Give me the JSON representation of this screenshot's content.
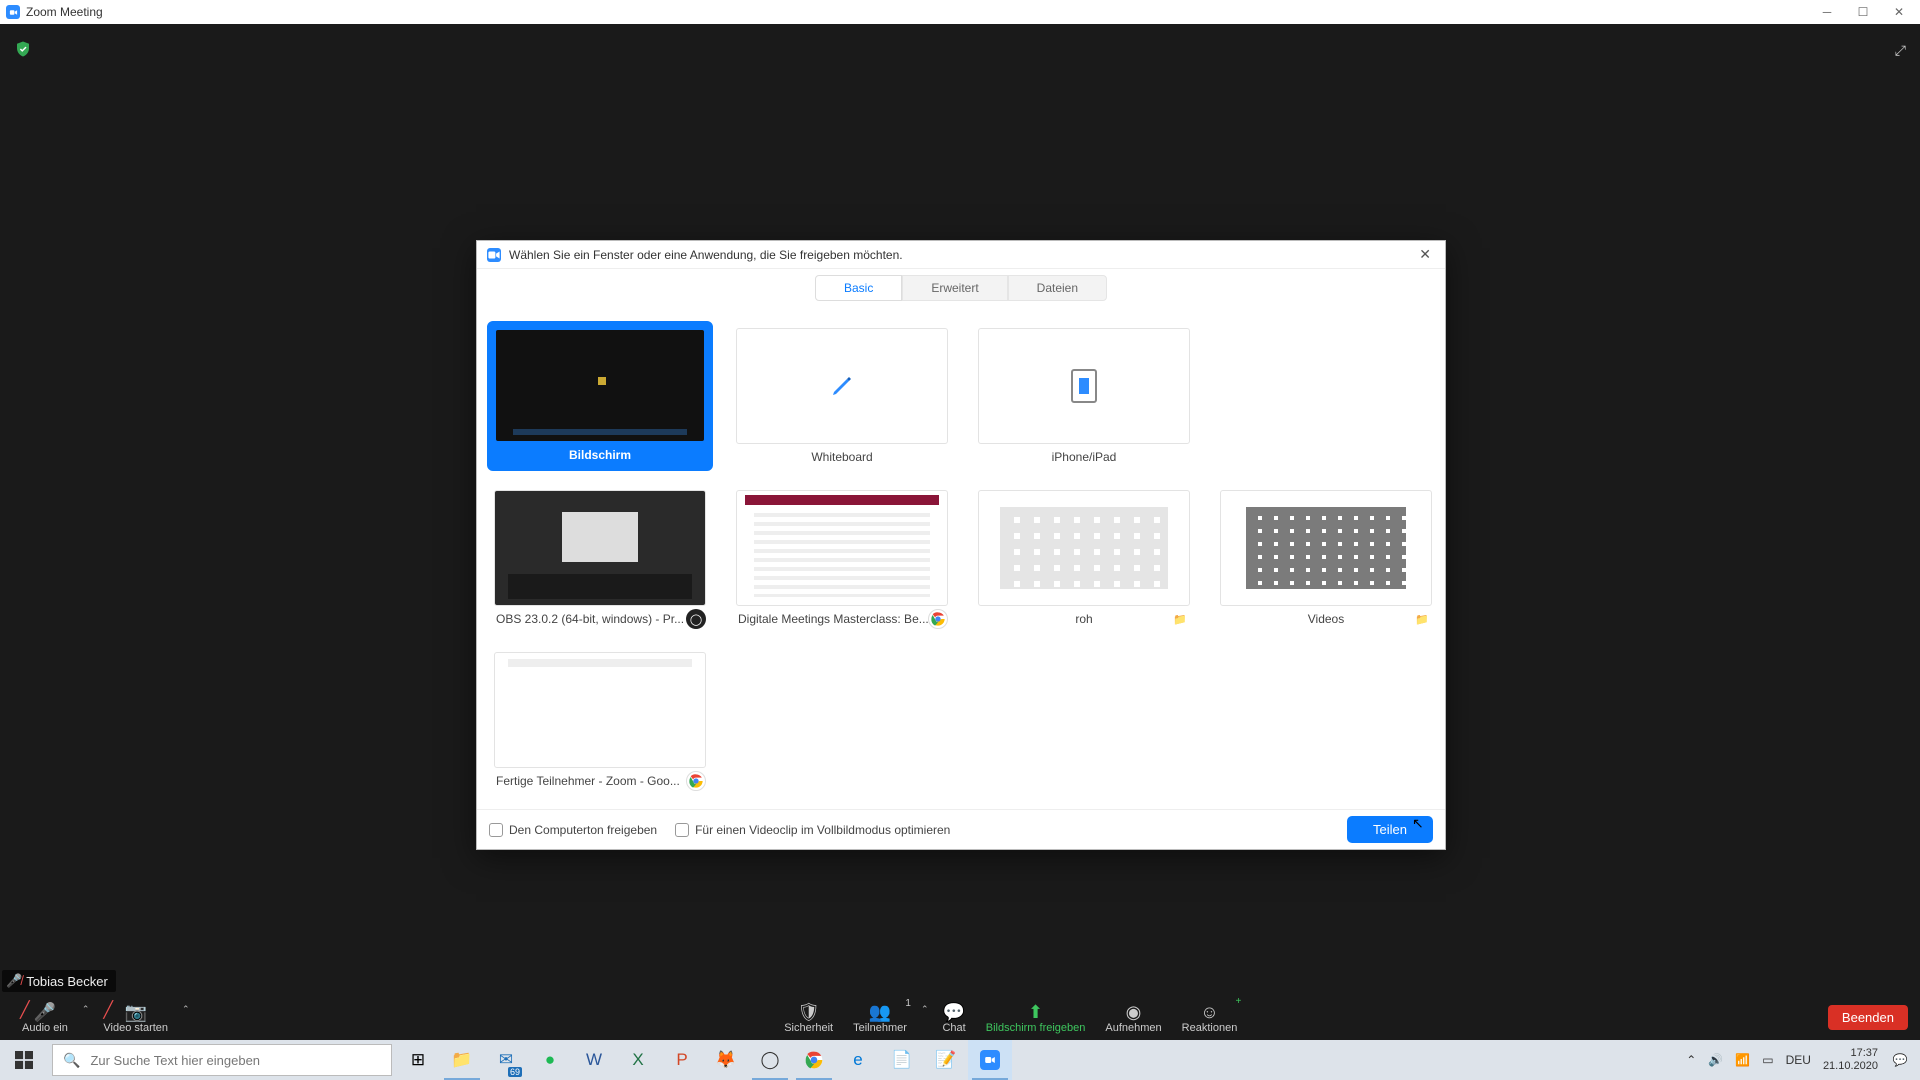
{
  "window": {
    "title": "Zoom Meeting"
  },
  "participant": {
    "name": "Tobias Becker"
  },
  "controls": {
    "audio": "Audio ein",
    "video": "Video starten",
    "security": "Sicherheit",
    "participants": "Teilnehmer",
    "participants_count": "1",
    "chat": "Chat",
    "share": "Bildschirm freigeben",
    "record": "Aufnehmen",
    "reactions": "Reaktionen",
    "end": "Beenden"
  },
  "dialog": {
    "title": "Wählen Sie ein Fenster oder eine Anwendung, die Sie freigeben möchten.",
    "tabs": {
      "basic": "Basic",
      "advanced": "Erweitert",
      "files": "Dateien"
    },
    "items": {
      "screen": "Bildschirm",
      "whiteboard": "Whiteboard",
      "iphone": "iPhone/iPad",
      "obs": "OBS 23.0.2 (64-bit, windows) - Pr...",
      "chrome1": "Digitale Meetings Masterclass: Be...",
      "roh": "roh",
      "videos": "Videos",
      "chrome2": "Fertige Teilnehmer - Zoom - Goo..."
    },
    "footer": {
      "check_audio": "Den Computerton freigeben",
      "check_video": "Für einen Videoclip im Vollbildmodus optimieren",
      "share": "Teilen"
    }
  },
  "taskbar": {
    "search_placeholder": "Zur Suche Text hier eingeben",
    "lang": "DEU",
    "time": "17:37",
    "date": "21.10.2020"
  }
}
